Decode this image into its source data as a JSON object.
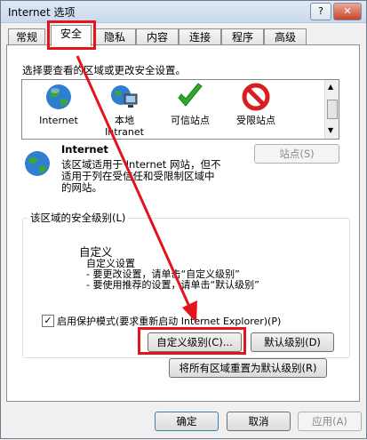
{
  "window": {
    "title": "Internet 选项",
    "help_button": "?",
    "close_button": "✕"
  },
  "tabs": [
    {
      "label": "常规"
    },
    {
      "label": "安全"
    },
    {
      "label": "隐私"
    },
    {
      "label": "内容"
    },
    {
      "label": "连接"
    },
    {
      "label": "程序"
    },
    {
      "label": "高级"
    }
  ],
  "security": {
    "zone_prompt": "选择要查看的区域或更改安全设置。",
    "zones": [
      {
        "label": "Internet",
        "icon": "globe-icon"
      },
      {
        "label": "本地\nIntranet",
        "icon": "intranet-icon"
      },
      {
        "label": "可信站点",
        "icon": "checkmark-icon"
      },
      {
        "label": "受限站点",
        "icon": "restricted-icon"
      }
    ],
    "selected_zone_title": "Internet",
    "selected_zone_desc": "该区域适用于 Internet 网站，但不适用于列在受信任和受限制区域中的网站。",
    "sites_button": "站点(S)",
    "level_group_label": "该区域的安全级别(L)",
    "custom_title": "自定义",
    "custom_lines": [
      "自定义设置",
      "- 要更改设置，请单击“自定义级别”",
      "- 要使用推荐的设置，请单击“默认级别”"
    ],
    "protected_mode_label": "启用保护模式(要求重新启动 Internet Explorer)(P)",
    "protected_mode_checked": true,
    "custom_level_button": "自定义级别(C)...",
    "default_level_button": "默认级别(D)",
    "reset_all_button": "将所有区域重置为默认级别(R)"
  },
  "footer": {
    "ok": "确定",
    "cancel": "取消",
    "apply": "应用(A)"
  },
  "colors": {
    "annotation_red": "#e3141b"
  }
}
